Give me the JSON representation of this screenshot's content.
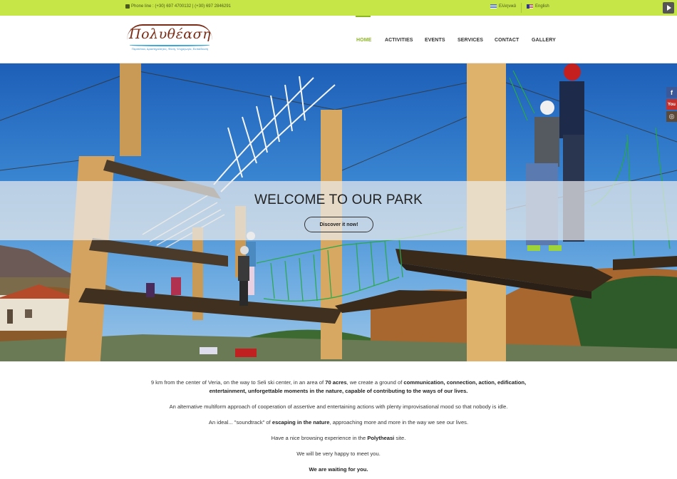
{
  "topbar": {
    "phone": "Phone line : (+30) 697 4700132 | (+30) 697 2846291",
    "lang_greek": "Ελληνικά",
    "lang_english": "English"
  },
  "logo": {
    "text": "Πολυθέαση",
    "tagline": "Περιπέτεια, Δραστηριότητες, Φύση, Ψυχαγωγία, Εκπαίδευση"
  },
  "nav": {
    "items": [
      "HOME",
      "ACTIVITIES",
      "EVENTS",
      "SERVICES",
      "CONTACT",
      "GALLERY"
    ],
    "active": "HOME"
  },
  "hero": {
    "title": "WELCOME TO OUR PARK",
    "button": "Discover it now!"
  },
  "social": [
    "facebook-icon",
    "youtube-icon",
    "instagram-icon"
  ],
  "colors": {
    "topbar": "#c6e546",
    "accent": "#8cb524",
    "logo_brown": "#7a2b15"
  },
  "content": {
    "p1_a": "9 km from the center of Veria, on the way to Seli ski center, in an area of ",
    "p1_b": "70 acres",
    "p1_c": ", we create a ground of ",
    "p1_d": "communication, connection, action, edification,",
    "p1_e": "entertainment, unforgettable moments in the nature, capable of contributing to the ways of our lives.",
    "p2": "An alternative multiform approach of cooperation of assertive and entertaining actions with plenty improvisational mood so that nobody is idle.",
    "p3_a": "An ideal... \"soundtrack\" of ",
    "p3_b": "escaping in the nature",
    "p3_c": ", approaching more and more in the way we see our lives.",
    "p4_a": "Have a nice browsing experience in the ",
    "p4_b": "Polytheasi",
    "p4_c": " site.",
    "p5": "We will be very happy to meet you.",
    "p6": "We are waiting for you."
  }
}
